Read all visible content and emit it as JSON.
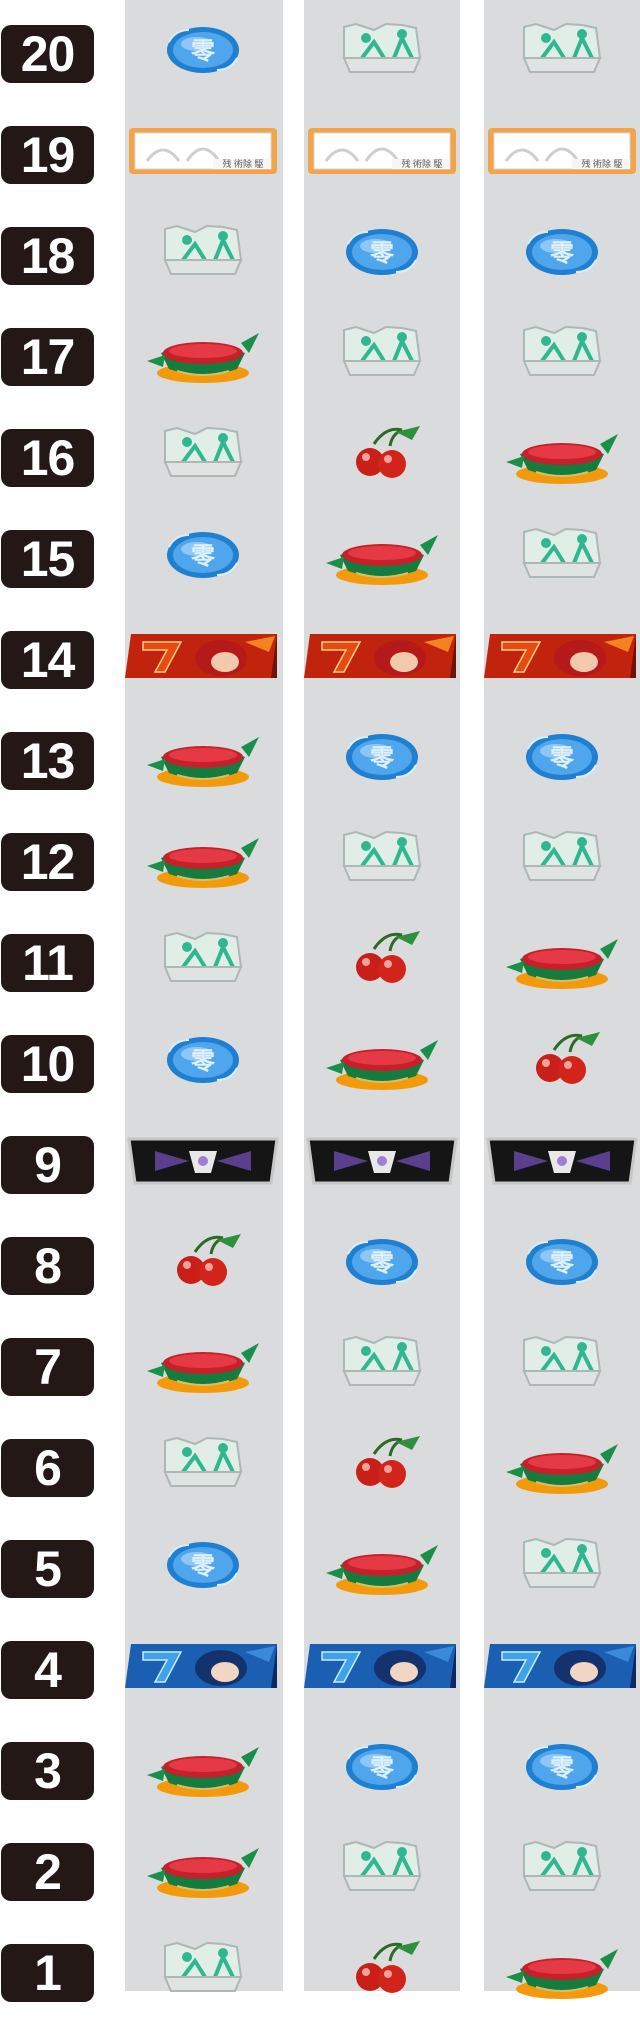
{
  "rows": [
    {
      "number": "20",
      "symbols": [
        "replay",
        "bell",
        "bell"
      ]
    },
    {
      "number": "19",
      "symbols": [
        "bar",
        "bar",
        "bar"
      ]
    },
    {
      "number": "18",
      "symbols": [
        "bell",
        "replay",
        "replay"
      ]
    },
    {
      "number": "17",
      "symbols": [
        "watermelon",
        "bell",
        "bell"
      ]
    },
    {
      "number": "16",
      "symbols": [
        "bell",
        "cherry",
        "watermelon"
      ]
    },
    {
      "number": "15",
      "symbols": [
        "replay",
        "watermelon",
        "bell"
      ]
    },
    {
      "number": "14",
      "symbols": [
        "red7",
        "red7",
        "red7"
      ]
    },
    {
      "number": "13",
      "symbols": [
        "watermelon",
        "replay",
        "replay"
      ]
    },
    {
      "number": "12",
      "symbols": [
        "watermelon",
        "bell",
        "bell"
      ]
    },
    {
      "number": "11",
      "symbols": [
        "bell",
        "cherry",
        "watermelon"
      ]
    },
    {
      "number": "10",
      "symbols": [
        "replay",
        "watermelon",
        "cherry"
      ]
    },
    {
      "number": "9",
      "symbols": [
        "blank",
        "blank",
        "blank"
      ]
    },
    {
      "number": "8",
      "symbols": [
        "cherry",
        "replay",
        "replay"
      ]
    },
    {
      "number": "7",
      "symbols": [
        "watermelon",
        "bell",
        "bell"
      ]
    },
    {
      "number": "6",
      "symbols": [
        "bell",
        "cherry",
        "watermelon"
      ]
    },
    {
      "number": "5",
      "symbols": [
        "replay",
        "watermelon",
        "bell"
      ]
    },
    {
      "number": "4",
      "symbols": [
        "blue7",
        "blue7",
        "blue7"
      ]
    },
    {
      "number": "3",
      "symbols": [
        "watermelon",
        "replay",
        "replay"
      ]
    },
    {
      "number": "2",
      "symbols": [
        "watermelon",
        "bell",
        "bell"
      ]
    },
    {
      "number": "1",
      "symbols": [
        "bell",
        "cherry",
        "watermelon"
      ]
    }
  ],
  "symbol_text": {
    "replay_glyph": "零",
    "bar_text": "残 術除 駆"
  }
}
